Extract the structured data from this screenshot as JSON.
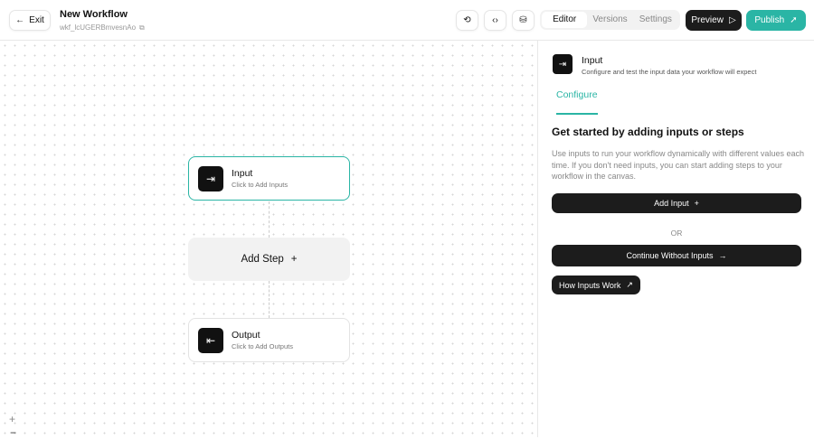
{
  "header": {
    "exit_label": "Exit",
    "title": "New Workflow",
    "workflow_id": "wkf_lcUGERBmvesnAo",
    "tabs": [
      {
        "label": "Editor"
      },
      {
        "label": "Versions"
      },
      {
        "label": "Settings"
      }
    ],
    "preview_label": "Preview",
    "publish_label": "Publish"
  },
  "canvas": {
    "input_node": {
      "title": "Input",
      "subtitle": "Click to Add Inputs"
    },
    "add_step_label": "Add Step",
    "output_node": {
      "title": "Output",
      "subtitle": "Click to Add Outputs"
    },
    "zoom_in": "+",
    "zoom_out": "−"
  },
  "panel": {
    "title": "Input",
    "subtitle": "Configure and test the input data your workflow will expect",
    "tab": "Configure",
    "heading": "Get started by adding inputs or steps",
    "description": "Use inputs to run your workflow dynamically with different values each time. If you don't need inputs, you can start adding steps to your workflow in the canvas.",
    "add_input_label": "Add Input",
    "or_label": "OR",
    "continue_label": "Continue Without Inputs",
    "how_label": "How Inputs Work"
  },
  "colors": {
    "accent": "#2ab5a5",
    "dark": "#1c1c1c"
  }
}
